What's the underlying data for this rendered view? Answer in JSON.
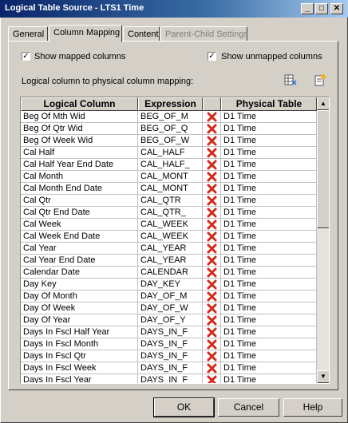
{
  "window": {
    "title": "Logical Table Source - LTS1 Time",
    "minimize_glyph": "_",
    "maximize_glyph": "□",
    "close_glyph": "✕"
  },
  "tabs": [
    {
      "label": "General",
      "state": "normal"
    },
    {
      "label": "Column Mapping",
      "state": "active"
    },
    {
      "label": "Content",
      "state": "normal"
    },
    {
      "label": "Parent-Child Settings",
      "state": "disabled"
    }
  ],
  "options": {
    "show_mapped_label": "Show mapped columns",
    "show_mapped_checked": true,
    "show_unmapped_label": "Show unmapped columns",
    "show_unmapped_checked": true
  },
  "mapping_label": "Logical column to physical column mapping:",
  "table": {
    "headers": {
      "logical": "Logical Column",
      "expression": "Expression",
      "physical": "Physical Table"
    },
    "rows": [
      {
        "logical": "Beg Of Mth Wid",
        "expression": "BEG_OF_M",
        "physical": "D1 Time"
      },
      {
        "logical": "Beg Of Qtr Wid",
        "expression": "BEG_OF_Q",
        "physical": "D1 Time"
      },
      {
        "logical": "Beg Of Week Wid",
        "expression": "BEG_OF_W",
        "physical": "D1 Time"
      },
      {
        "logical": "Cal Half",
        "expression": "CAL_HALF",
        "physical": "D1 Time"
      },
      {
        "logical": "Cal Half Year End Date",
        "expression": "CAL_HALF_",
        "physical": "D1 Time"
      },
      {
        "logical": "Cal Month",
        "expression": "CAL_MONT",
        "physical": "D1 Time"
      },
      {
        "logical": "Cal Month End Date",
        "expression": "CAL_MONT",
        "physical": "D1 Time"
      },
      {
        "logical": "Cal Qtr",
        "expression": "CAL_QTR",
        "physical": "D1 Time"
      },
      {
        "logical": "Cal Qtr End Date",
        "expression": "CAL_QTR_",
        "physical": "D1 Time"
      },
      {
        "logical": "Cal Week",
        "expression": "CAL_WEEK",
        "physical": "D1 Time"
      },
      {
        "logical": "Cal Week End Date",
        "expression": "CAL_WEEK",
        "physical": "D1 Time"
      },
      {
        "logical": "Cal Year",
        "expression": "CAL_YEAR",
        "physical": "D1 Time"
      },
      {
        "logical": "Cal Year End Date",
        "expression": "CAL_YEAR",
        "physical": "D1 Time"
      },
      {
        "logical": "Calendar Date",
        "expression": "CALENDAR",
        "physical": "D1 Time"
      },
      {
        "logical": "Day Key",
        "expression": "DAY_KEY",
        "physical": "D1 Time"
      },
      {
        "logical": "Day Of Month",
        "expression": "DAY_OF_M",
        "physical": "D1 Time"
      },
      {
        "logical": "Day Of Week",
        "expression": "DAY_OF_W",
        "physical": "D1 Time"
      },
      {
        "logical": "Day Of Year",
        "expression": "DAY_OF_Y",
        "physical": "D1 Time"
      },
      {
        "logical": "Days In Fscl Half Year",
        "expression": "DAYS_IN_F",
        "physical": "D1 Time"
      },
      {
        "logical": "Days In Fscl Month",
        "expression": "DAYS_IN_F",
        "physical": "D1 Time"
      },
      {
        "logical": "Days In Fscl Qtr",
        "expression": "DAYS_IN_F",
        "physical": "D1 Time"
      },
      {
        "logical": "Days In Fscl Week",
        "expression": "DAYS_IN_F",
        "physical": "D1 Time"
      },
      {
        "logical": "Days In Fscl Year",
        "expression": "DAYS_IN_F",
        "physical": "D1 Time"
      }
    ]
  },
  "buttons": {
    "ok": "OK",
    "cancel": "Cancel",
    "help": "Help"
  },
  "colors": {
    "titlebar": "#0a246a",
    "delete_icon": "#d22a1e"
  }
}
